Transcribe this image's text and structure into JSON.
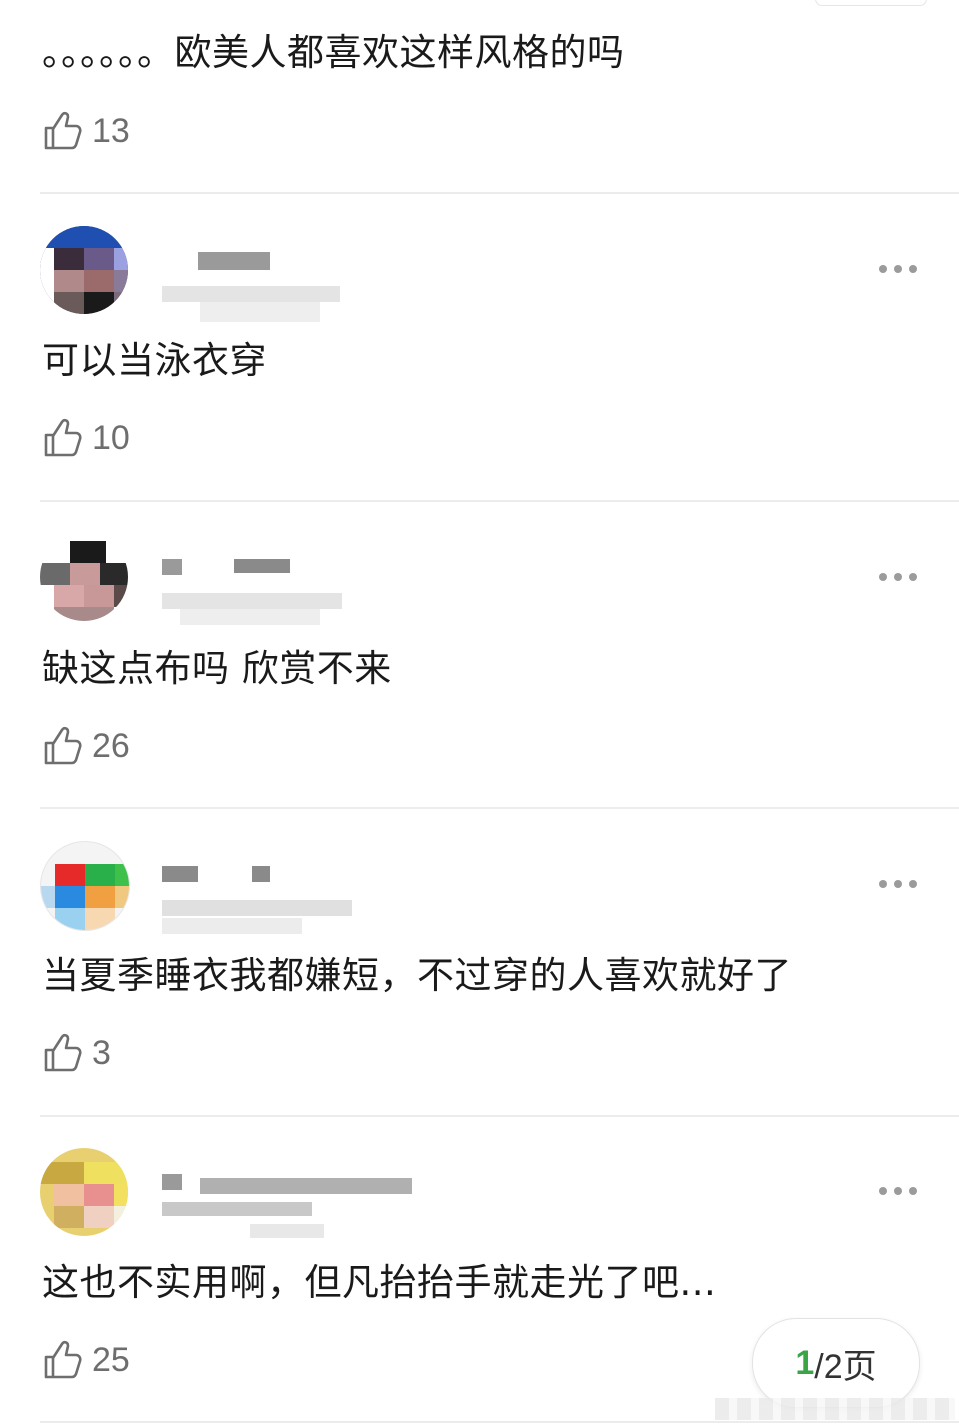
{
  "top_comment": {
    "text": "。。。。。。欧美人都喜欢这样风格的吗",
    "likes": "13"
  },
  "comments": [
    {
      "text": "可以当泳衣穿",
      "likes": "10"
    },
    {
      "text": "缺这点布吗 欣赏不来",
      "likes": "26"
    },
    {
      "text": "当夏季睡衣我都嫌短，不过穿的人喜欢就好了",
      "likes": "3"
    },
    {
      "text": "这也不实用啊，但凡抬抬手就走光了吧...",
      "likes": "25"
    }
  ],
  "pager": {
    "current": "1",
    "total_label": "/2页"
  },
  "icons": {
    "like": "thumbs-up-icon",
    "more": "more-dots-icon"
  },
  "colors": {
    "accent": "#3aa546",
    "text": "#1a1a1a",
    "muted": "#6e6e6e"
  }
}
